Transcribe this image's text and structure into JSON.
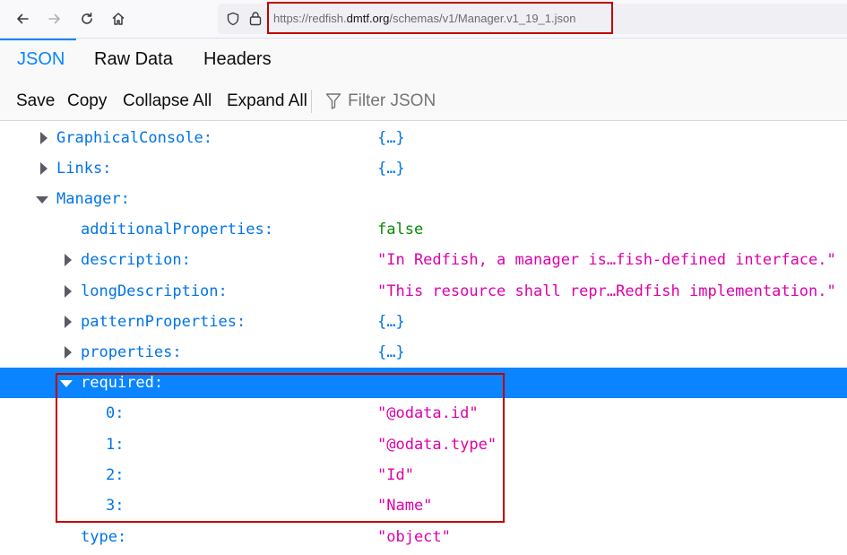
{
  "browser": {
    "url": {
      "prefix": "https://redfish.",
      "domain": "dmtf.org",
      "path": "/schemas/v1/Manager.v1_19_1.json"
    }
  },
  "tabs": [
    {
      "label": "JSON",
      "active": true
    },
    {
      "label": "Raw Data",
      "active": false
    },
    {
      "label": "Headers",
      "active": false
    }
  ],
  "toolbar": {
    "save": "Save",
    "copy": "Copy",
    "collapse_all": "Collapse All",
    "expand_all": "Expand All",
    "filter_placeholder": "Filter JSON"
  },
  "tree": {
    "rows": [
      {
        "key": "GraphicalConsole:",
        "value": "{…}",
        "state": "collapsed"
      },
      {
        "key": "Links:",
        "value": "{…}",
        "state": "collapsed"
      },
      {
        "key": "Manager:",
        "value": "",
        "state": "expanded"
      },
      {
        "key": "additionalProperties:",
        "value": "false",
        "state": "leaf"
      },
      {
        "key": "description:",
        "value": "\"In Redfish, a manager is…fish-defined interface.\"",
        "state": "collapsed"
      },
      {
        "key": "longDescription:",
        "value": "\"This resource shall repr…Redfish implementation.\"",
        "state": "collapsed"
      },
      {
        "key": "patternProperties:",
        "value": "{…}",
        "state": "collapsed"
      },
      {
        "key": "properties:",
        "value": "{…}",
        "state": "collapsed"
      },
      {
        "key": "required:",
        "value": "",
        "state": "expanded",
        "selected": true
      },
      {
        "key": "0:",
        "value": "\"@odata.id\"",
        "state": "leaf"
      },
      {
        "key": "1:",
        "value": "\"@odata.type\"",
        "state": "leaf"
      },
      {
        "key": "2:",
        "value": "\"Id\"",
        "state": "leaf"
      },
      {
        "key": "3:",
        "value": "\"Name\"",
        "state": "leaf"
      },
      {
        "key": "type:",
        "value": "\"object\"",
        "state": "leaf"
      }
    ]
  },
  "colors": {
    "accent": "#0a84ff",
    "key": "#0074e8",
    "string": "#dd00a9",
    "boolean": "#058b00",
    "annotation": "#c00000"
  }
}
